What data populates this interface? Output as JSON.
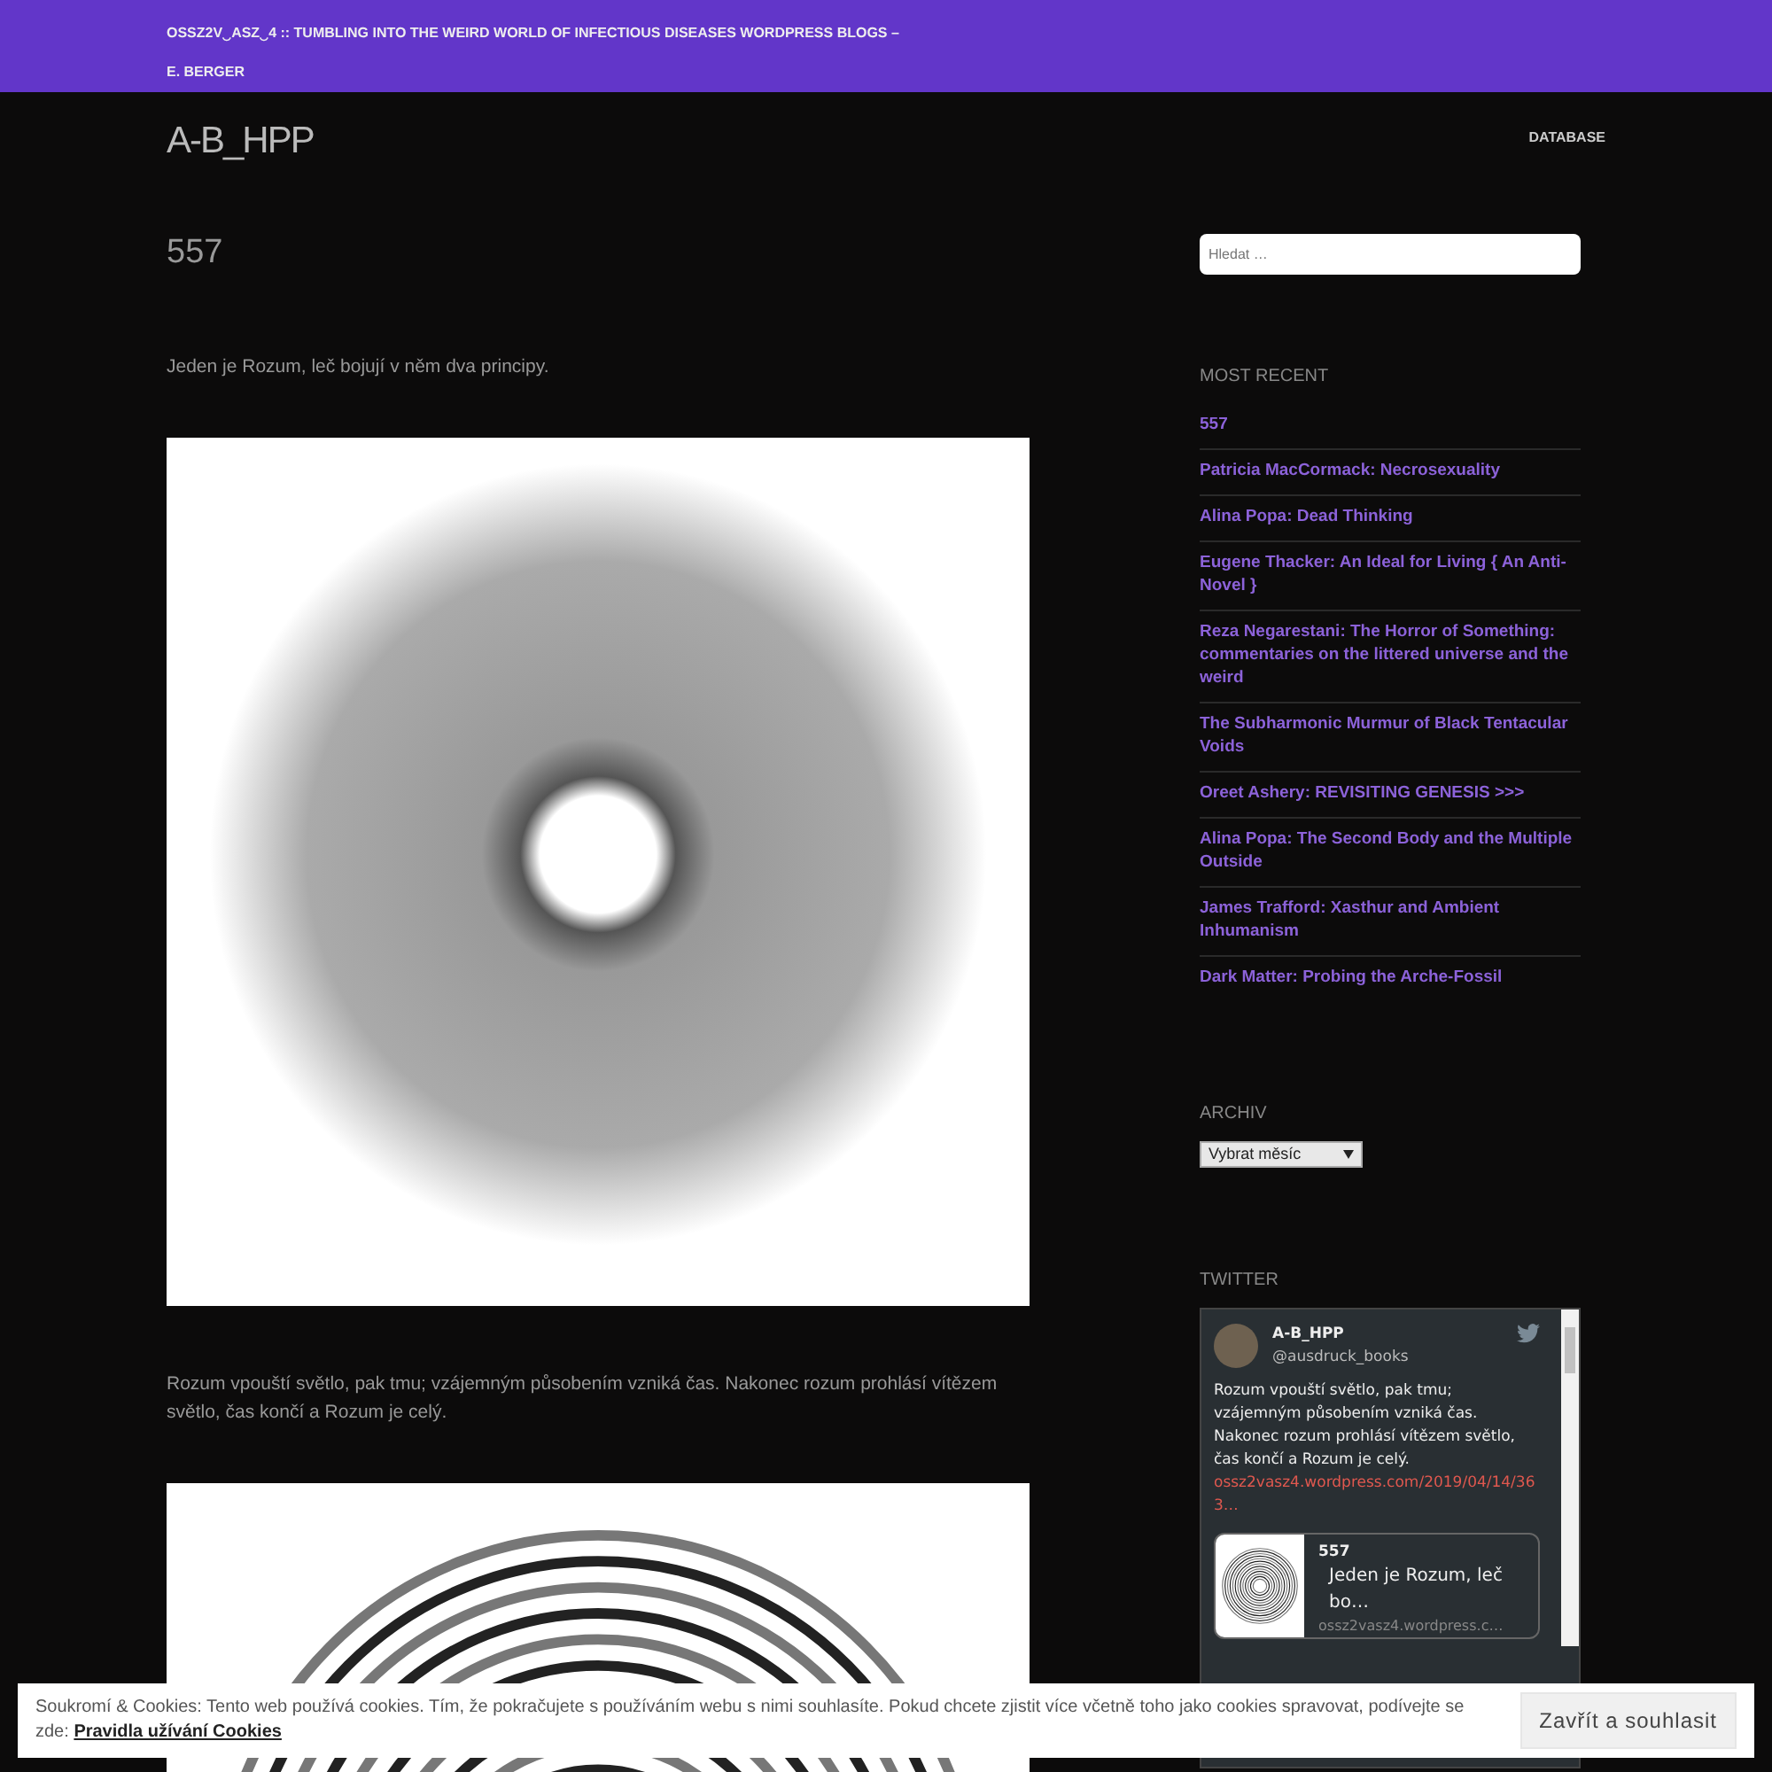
{
  "top_bar": {
    "title": "OSSZ2V‿ASZ‿4 :: TUMBLING INTO THE WEIRD WORLD OF INFECTIOUS DISEASES WORDPRESS BLOGS – E. BERGER"
  },
  "header": {
    "site_title": "A-B_HPP",
    "nav": [
      {
        "label": "DATABASE"
      }
    ]
  },
  "post": {
    "title": "557",
    "blocks": [
      {
        "kind": "text",
        "text": "Jeden je Rozum, leč bojují v něm dva principy."
      },
      {
        "kind": "image"
      },
      {
        "kind": "text",
        "text": "Rozum vpouští světlo, pak tmu; vzájemným působením vzniká čas. Nakonec rozum prohlásí vítězem světlo, čas končí a Rozum je celý."
      },
      {
        "kind": "image"
      }
    ]
  },
  "sidebar": {
    "search": {
      "placeholder": "Hledat …"
    },
    "recent": {
      "heading": "MOST RECENT",
      "items": [
        "557",
        "Patricia MacCormack: Necrosexuality",
        "Alina Popa: Dead Thinking",
        "Eugene Thacker: An Ideal for Living { An Anti-Novel }",
        "Reza Negarestani: The Horror of Something: commentaries on the littered universe and the weird",
        "The Subharmonic Murmur of Black Tentacular Voids",
        "Oreet Ashery: REVISITING GENESIS >>>",
        "Alina Popa: The Second Body and the Multiple Outside",
        "James Trafford: Xasthur and Ambient Inhumanism",
        "Dark Matter: Probing the Arche-Fossil"
      ]
    },
    "archive": {
      "heading": "ARCHIV",
      "select": "Vybrat měsíc"
    },
    "twitter": {
      "heading": "TWITTER",
      "tweets": [
        {
          "name": "A-B_HPP",
          "handle": "@ausdruck_books",
          "text": "Rozum vpouští světlo, pak tmu; vzájemným působením vzniká čas. Nakonec rozum prohlásí vítězem světlo, čas končí a Rozum je celý.",
          "link": "ossz2vasz4.wordpress.com/2019/04/14/363…",
          "card": {
            "title": "557",
            "description": "Jeden je Rozum, leč bo…",
            "domain": "ossz2vasz4.wordpress.c…"
          }
        }
      ]
    }
  },
  "cookie_bar": {
    "text": "Soukromí & Cookies: Tento web používá cookies. Tím, že pokračujete s používáním webu s nimi souhlasíte. Pokud chcete zjistit více včetně toho jako cookies spravovat, podívejte se zde:",
    "link": "Pravidla užívání Cookies",
    "button": "Zavřít a souhlasit"
  }
}
